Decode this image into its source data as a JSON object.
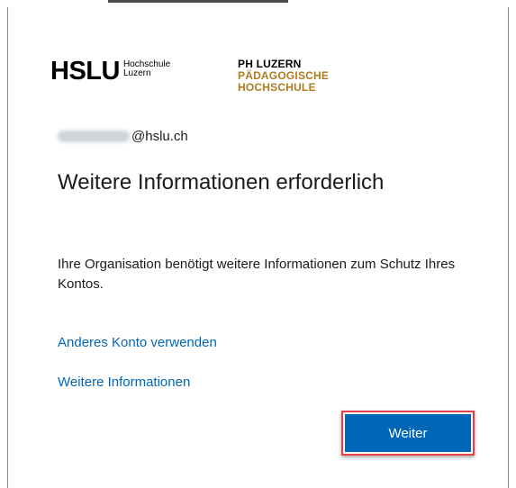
{
  "logos": {
    "hslu_main": "HSLU",
    "hslu_sub_1": "Hochschule",
    "hslu_sub_2": "Luzern",
    "ph_line_1": "PH LUZERN",
    "ph_line_2": "PÄDAGOGISCHE",
    "ph_line_3": "HOCHSCHULE"
  },
  "identity": {
    "domain": "@hslu.ch"
  },
  "title": "Weitere Informationen erforderlich",
  "description": "Ihre Organisation benötigt weitere Informationen zum Schutz Ihres Kontos.",
  "links": {
    "other_account": "Anderes Konto verwenden",
    "more_info": "Weitere Informationen"
  },
  "buttons": {
    "next": "Weiter"
  },
  "colors": {
    "link": "#0067b8",
    "primary_button": "#0067b8",
    "highlight_border": "#e8404a",
    "ph_accent": "#b07a1e"
  }
}
